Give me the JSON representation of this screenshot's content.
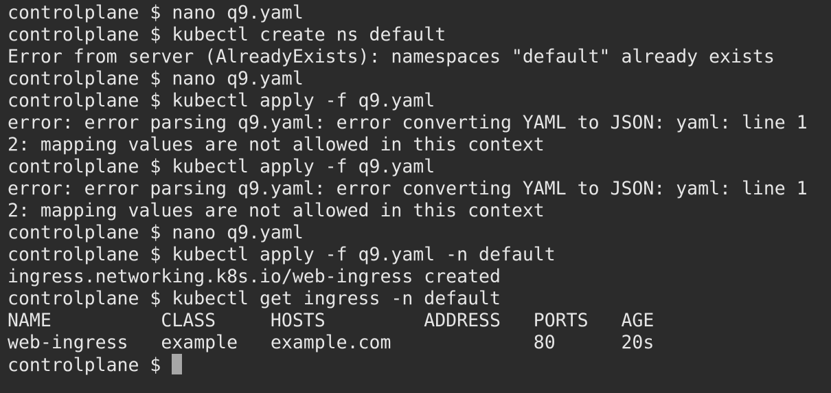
{
  "terminal": {
    "prompt": "controlplane $",
    "lines": [
      "controlplane $ nano q9.yaml",
      "controlplane $ kubectl create ns default",
      "Error from server (AlreadyExists): namespaces \"default\" already exists",
      "controlplane $ nano q9.yaml",
      "controlplane $ kubectl apply -f q9.yaml",
      "error: error parsing q9.yaml: error converting YAML to JSON: yaml: line 1",
      "2: mapping values are not allowed in this context",
      "controlplane $ kubectl apply -f q9.yaml",
      "error: error parsing q9.yaml: error converting YAML to JSON: yaml: line 1",
      "2: mapping values are not allowed in this context",
      "controlplane $ nano q9.yaml",
      "controlplane $ kubectl apply -f q9.yaml -n default",
      "ingress.networking.k8s.io/web-ingress created",
      "controlplane $ kubectl get ingress -n default",
      "NAME          CLASS     HOSTS         ADDRESS   PORTS   AGE",
      "web-ingress   example   example.com             80      20s"
    ],
    "current_prompt": "controlplane $ "
  },
  "colors": {
    "background": "#2b2b2b",
    "foreground": "#e6e6e6",
    "cursor": "#a7a7a7"
  }
}
